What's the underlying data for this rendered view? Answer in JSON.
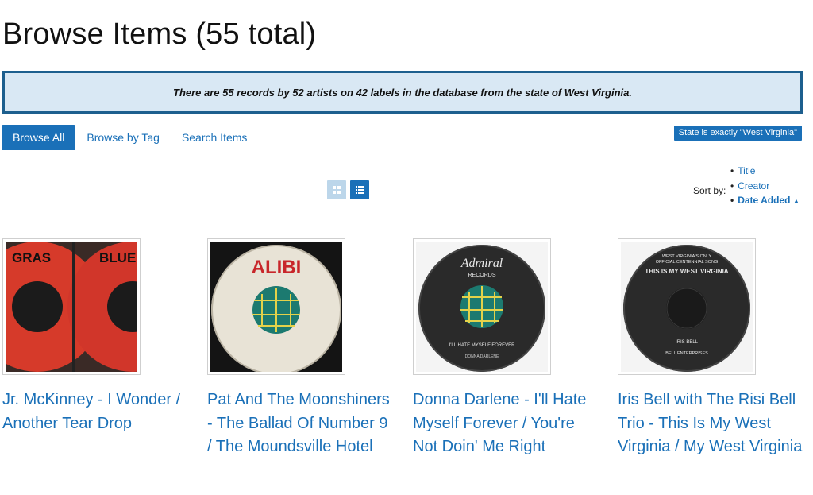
{
  "page": {
    "title": "Browse Items (55 total)"
  },
  "info": {
    "message": "There are 55 records by 52 artists on 42 labels in the database from the state of West Virginia."
  },
  "nav": {
    "tabs": [
      {
        "label": "Browse All",
        "active": true
      },
      {
        "label": "Browse by Tag",
        "active": false
      },
      {
        "label": "Search Items",
        "active": false
      }
    ]
  },
  "filter": {
    "label": "State is exactly \"West Virginia\""
  },
  "view": {
    "grid_icon": "grid-icon",
    "list_icon": "list-icon",
    "selected": "list"
  },
  "sort": {
    "label": "Sort by:",
    "options": [
      "Title",
      "Creator",
      "Date Added"
    ],
    "current": "Date Added",
    "direction_icon": "caret-up-icon"
  },
  "items": [
    {
      "title": "Jr. McKinney - I Wonder / Another Tear Drop",
      "image": {
        "label_color": "#d63a2a",
        "label_texts": [
          "GRAS",
          "BLUE"
        ]
      }
    },
    {
      "title": "Pat And The Moonshiners - The Ballad Of Number 9 / The Moundsville Hotel",
      "image": {
        "label_color": "#e8e3d6",
        "label_texts": [
          "ALIBI"
        ],
        "accent": "#c8262a"
      }
    },
    {
      "title": "Donna Darlene - I'll Hate Myself Forever / You're Not Doin' Me Right",
      "image": {
        "label_color": "#2a2a2a",
        "label_texts": [
          "Admiral",
          "RECORDS",
          "I'LL HATE MYSELF FOREVER",
          "DONNA DARLENE"
        ]
      }
    },
    {
      "title": "Iris Bell with The Risi Bell Trio - This Is My West Virginia / My West Virginia",
      "image": {
        "label_color": "#2a2a2a",
        "label_texts": [
          "WEST VIRGINIA'S ONLY",
          "OFFICIAL CENTENNIAL SONG",
          "THIS IS MY WEST VIRGINIA",
          "IRIS BELL",
          "BELL ENTERPRISES"
        ]
      }
    }
  ]
}
